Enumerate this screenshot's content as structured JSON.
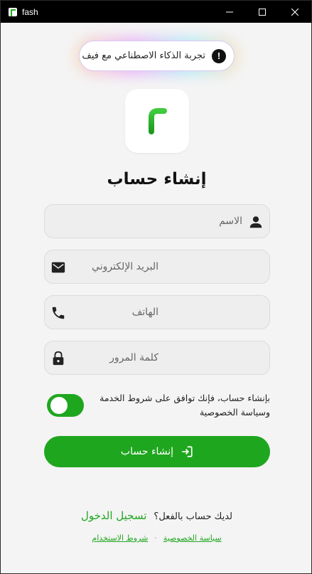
{
  "window": {
    "title": "fash"
  },
  "promo": {
    "text": "تجربة الذكاء الاصطناعي مع فيف",
    "icon": "alert-badge-icon"
  },
  "page": {
    "title": "إنشاء حساب"
  },
  "fields": {
    "name": {
      "placeholder": "الاسم",
      "icon": "person-icon"
    },
    "email": {
      "placeholder": "البريد الإلكتروني",
      "icon": "mail-icon"
    },
    "phone": {
      "placeholder": "الهاتف",
      "icon": "phone-icon"
    },
    "password": {
      "placeholder": "كلمة المرور",
      "icon": "lock-icon"
    }
  },
  "terms": {
    "text": "بإنشاء حساب، فإنك توافق على شروط الخدمة وسياسة الخصوصية",
    "toggle_on": true
  },
  "actions": {
    "create_account_label": "إنشاء حساب",
    "have_account_text": "لديك حساب بالفعل؟",
    "sign_in_link": "تسجيل الدخول"
  },
  "footer": {
    "privacy_link": "سياسة الخصوصية",
    "separator": "·",
    "terms_link": "شروط الاستخدام"
  },
  "colors": {
    "accent": "#1fa61f",
    "background": "#f4f4f4",
    "titlebar": "#000000"
  }
}
